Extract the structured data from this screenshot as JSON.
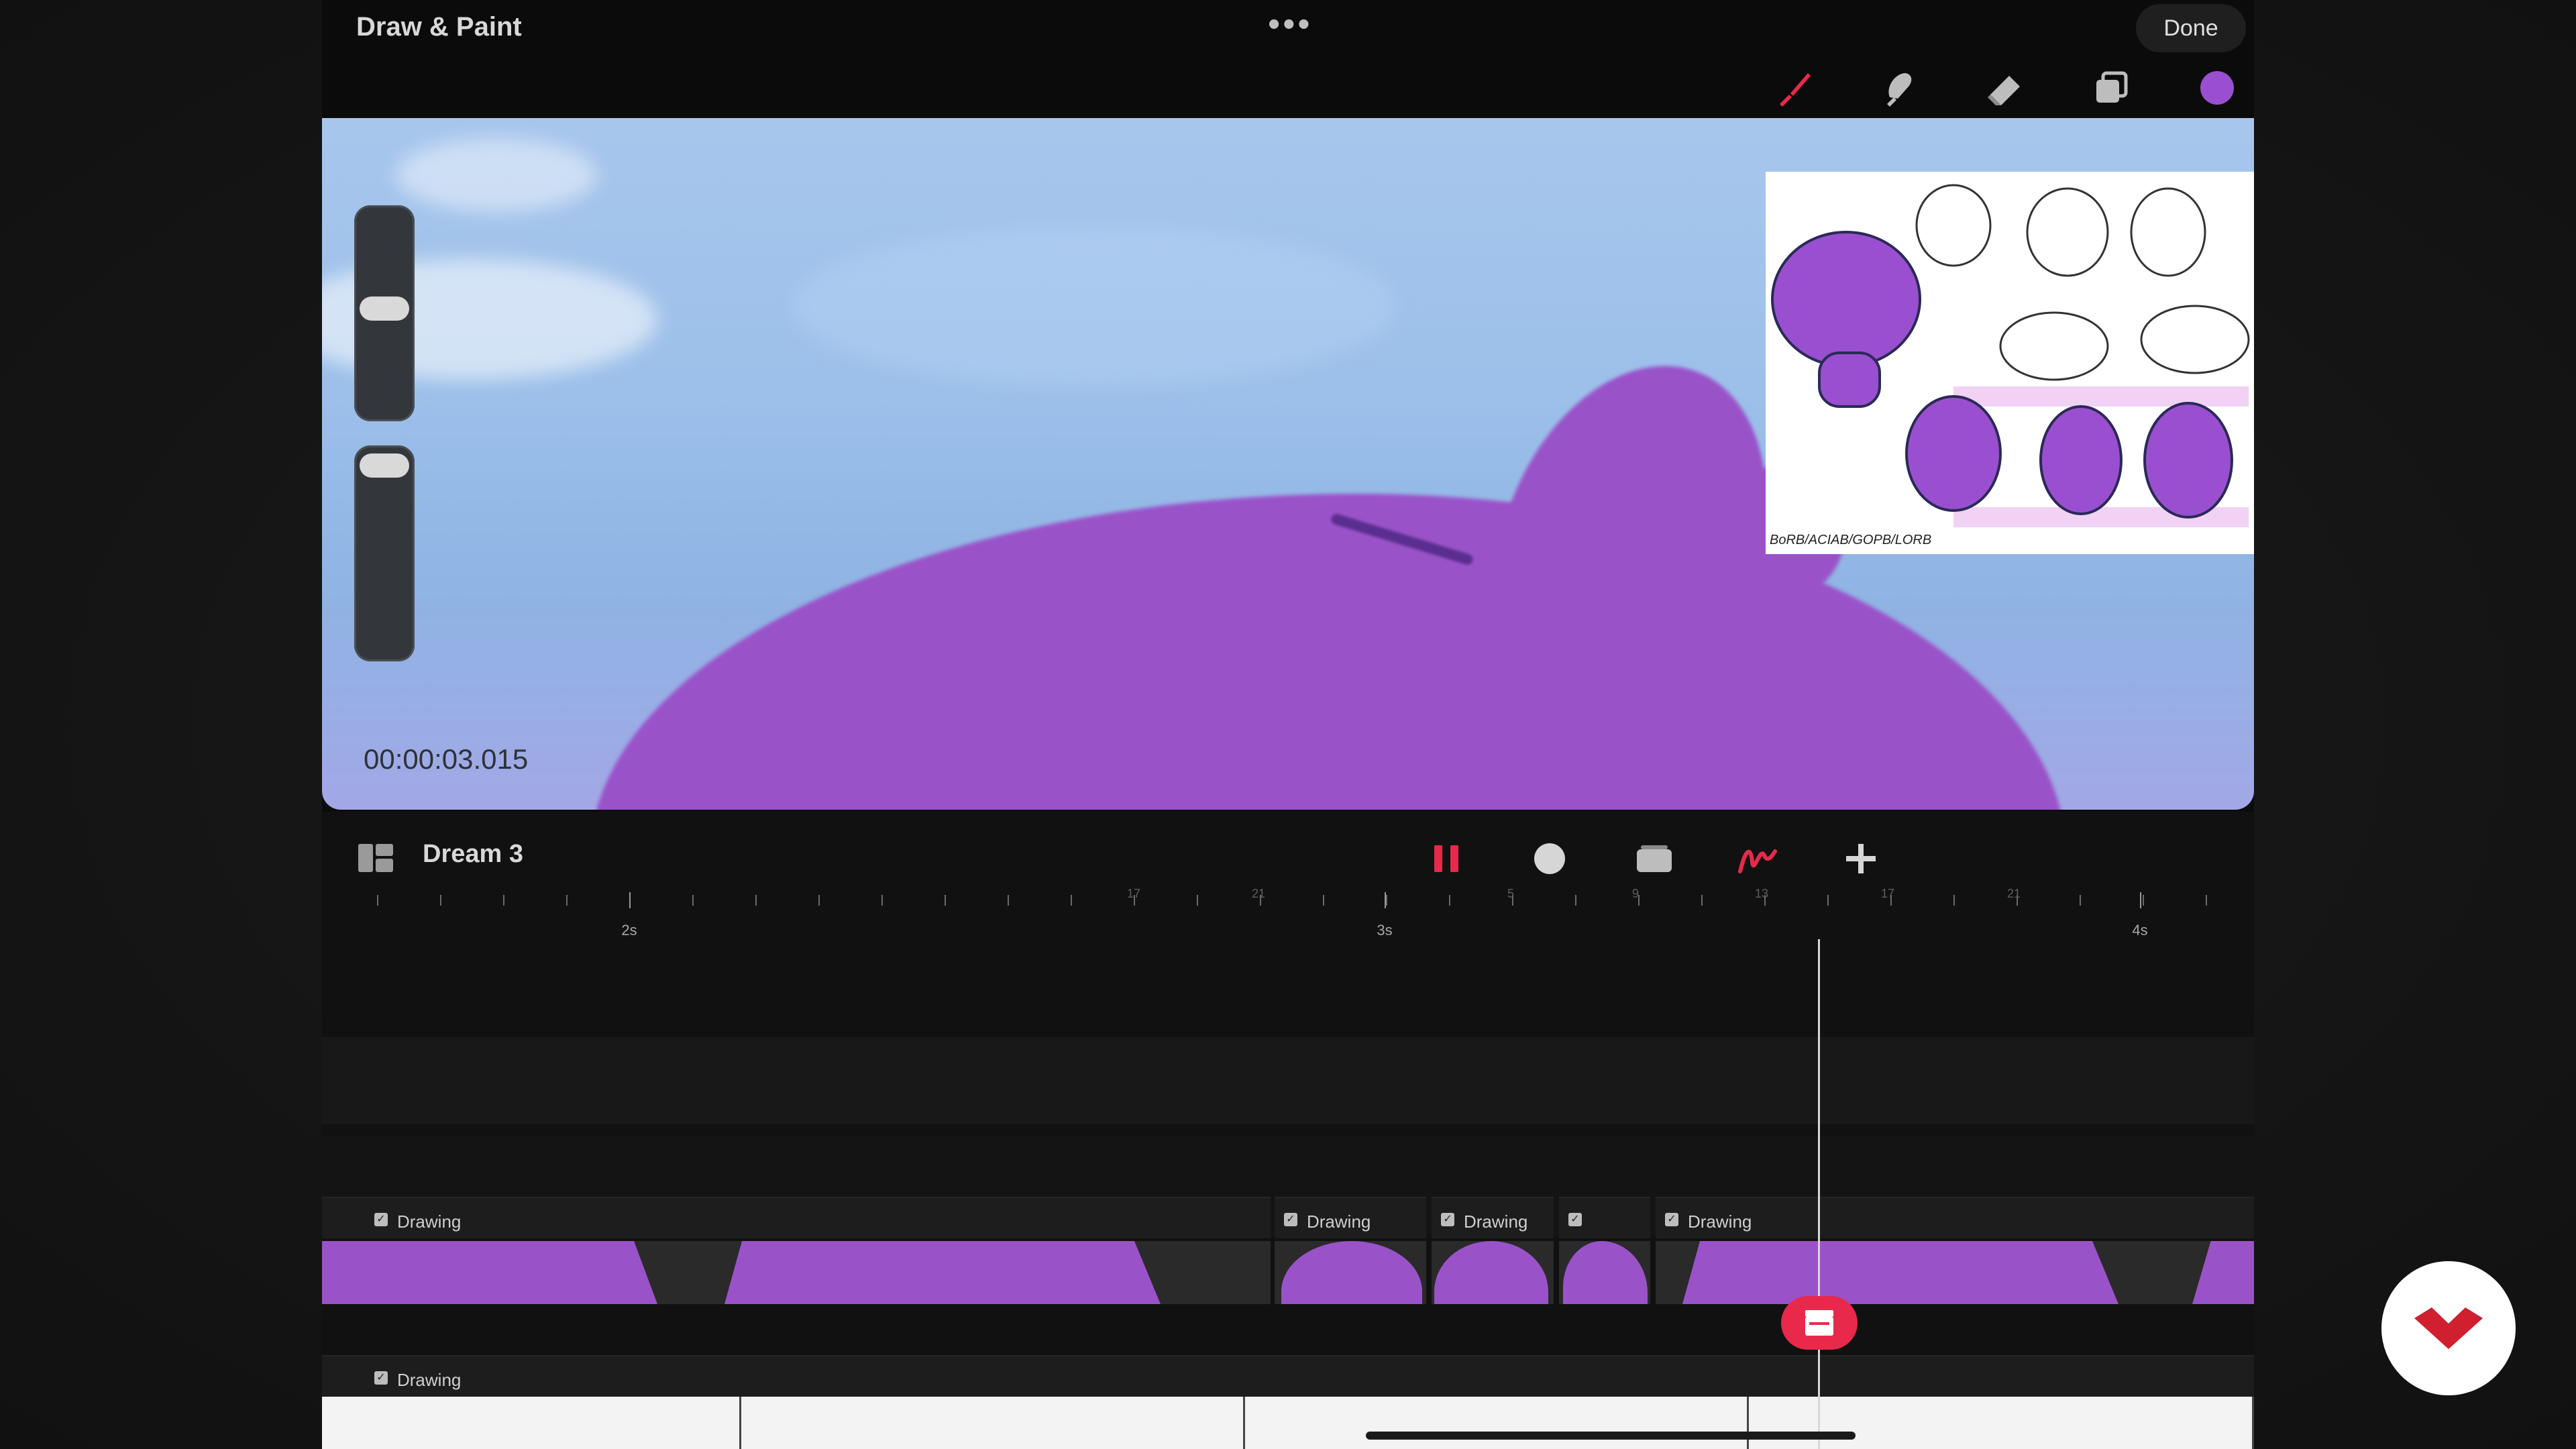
{
  "app": {
    "title": "Draw & Paint",
    "more": "•••",
    "done_label": "Done"
  },
  "toolbar": {
    "tools": [
      "brush-icon",
      "smudge-icon",
      "eraser-icon",
      "layers-icon",
      "color-icon"
    ],
    "accent": "#e8294b",
    "current_color": "#9a4fd0"
  },
  "canvas": {
    "timecode": "00:00:03.015",
    "reference_caption": "BoRB/ACIAB/GOPB/LORB"
  },
  "timeline": {
    "project_name": "Dream 3",
    "controls": [
      "pause-icon",
      "record-icon",
      "onion-skin-icon",
      "draw-icon",
      "add-icon"
    ],
    "ruler": {
      "major": [
        {
          "label": "2s"
        },
        {
          "label": "3s"
        },
        {
          "label": "4s"
        }
      ],
      "minor_labels": [
        "17",
        "21",
        "5",
        "9",
        "13",
        "17",
        "21"
      ]
    },
    "tracks": [
      {
        "clips": [
          "Drawing",
          "Drawing",
          "Drawing",
          "",
          "Drawing"
        ]
      },
      {
        "clips": [
          "Drawing"
        ]
      }
    ]
  },
  "brand": {
    "logo": "logo-icon",
    "color": "#d01f2f"
  }
}
